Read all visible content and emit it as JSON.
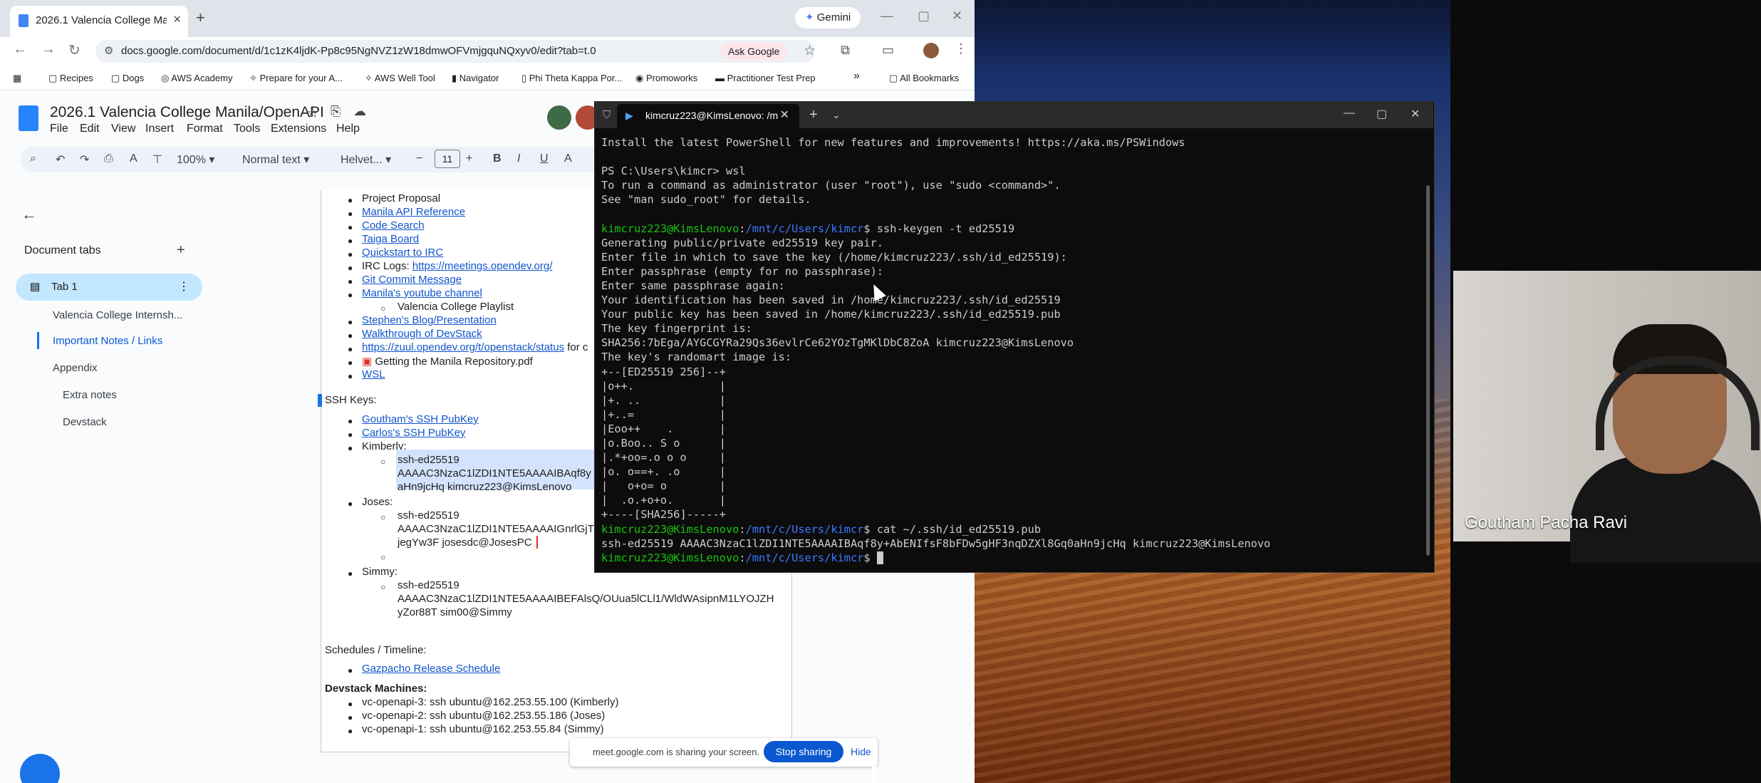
{
  "browser": {
    "tab_title": "2026.1 Valencia College Manila",
    "new_tab": "+",
    "gemini_label": "Gemini",
    "url": "docs.google.com/document/d/1c1zK4ljdK-Pp8c95NgNVZ1zW18dmwOFVmjgquNQxyv0/edit?tab=t.0",
    "ask_google": "Ask Google",
    "bookmarks": [
      "Recipes",
      "Dogs",
      "AWS Academy",
      "Prepare for your A...",
      "AWS Well Tool",
      "Navigator",
      "Phi Theta Kappa Por...",
      "Promoworks",
      "Practitioner Test Prep"
    ],
    "bookmarks_more": "»",
    "all_bookmarks": "All Bookmarks"
  },
  "docs": {
    "title": "2026.1 Valencia College Manila/OpenAPI",
    "menu": [
      "File",
      "Edit",
      "View",
      "Insert",
      "Format",
      "Tools",
      "Extensions",
      "Help"
    ],
    "zoom": "100%",
    "style": "Normal text",
    "font": "Helvet...",
    "font_size": "11",
    "sidebar": {
      "title": "Document tabs",
      "add": "+",
      "tab1": "Tab 1",
      "items": [
        "Valencia College Internsh...",
        "Important Notes / Links",
        "Appendix",
        "Extra notes",
        "Devstack"
      ]
    },
    "content": {
      "project_proposal": "Project Proposal",
      "links": [
        "Manila API Reference",
        "Code Search",
        "Taiga Board",
        "Quickstart to IRC"
      ],
      "irc_logs_label": "IRC Logs: ",
      "irc_logs_url": "https://meetings.opendev.org/",
      "links2": [
        "Git Commit Message",
        "Manila's youtube channel"
      ],
      "playlist": "Valencia College Playlist",
      "links3": [
        "Stephen's Blog/Presentation",
        "Walkthrough of DevStack"
      ],
      "zuul_url": "https://zuul.opendev.org/t/openstack/status",
      "zuul_after": " for c",
      "pdf": "Getting the Manila Repository.pdf",
      "wsl": "WSL",
      "ssh_keys": "SSH Keys:",
      "goutham_key": "Goutham's SSH PubKey",
      "carlos_key": "Carlos's SSH PubKey",
      "kimberly": "Kimberly:",
      "kim_key": [
        "ssh-ed25519",
        "AAAAC3NzaC1lZDI1NTE5AAAAIBAqf8y",
        "aHn9jcHq kimcruz223@KimsLenovo"
      ],
      "joses": "Joses:",
      "jose_key": [
        "ssh-ed25519",
        "AAAAC3NzaC1lZDI1NTE5AAAAIGnrlGjT",
        "jegYw3F josesdc@JosesPC"
      ],
      "simmy": "Simmy:",
      "simmy_key": [
        "ssh-ed25519",
        "AAAAC3NzaC1lZDI1NTE5AAAAIBEFAlsQ/OUua5lCLl1/WldWAsipnM1LYOJZH",
        "yZor88T sim00@Simmy"
      ],
      "schedules": "Schedules / Timeline:",
      "gazpacho": "Gazpacho Release Schedule",
      "devstack": "Devstack Machines:",
      "machines": [
        "vc-openapi-3: ssh ubuntu@162.253.55.100 (Kimberly)",
        "vc-openapi-2: ssh ubuntu@162.253.55.186 (Joses)",
        "vc-openapi-1: ssh ubuntu@162.253.55.84 (Simmy)"
      ]
    }
  },
  "meet": {
    "sharing": "meet.google.com is sharing your screen.",
    "stop": "Stop sharing",
    "hide": "Hide"
  },
  "terminal": {
    "tab_title": "kimcruz223@KimsLenovo: /m",
    "prompt_user": "kimcruz223@KimsLenovo",
    "prompt_path": "/mnt/c/Users/kimcr",
    "l1": "Install the latest PowerShell for new features and improvements! https://aka.ms/PSWindows",
    "l2": "PS C:\\Users\\kimcr> wsl",
    "l3": "To run a command as administrator (user \"root\"), use \"sudo <command>\".",
    "l4": "See \"man sudo_root\" for details.",
    "cmd1": "$ ssh-keygen -t ed25519",
    "l5": "Generating public/private ed25519 key pair.",
    "l6": "Enter file in which to save the key (/home/kimcruz223/.ssh/id_ed25519):",
    "l7": "Enter passphrase (empty for no passphrase):",
    "l8": "Enter same passphrase again:",
    "l9": "Your identification has been saved in /home/kimcruz223/.ssh/id_ed25519",
    "l10": "Your public key has been saved in /home/kimcruz223/.ssh/id_ed25519.pub",
    "l11": "The key fingerprint is:",
    "l12": "SHA256:7bEga/AYGCGYRa29Qs36evlrCe62YOzTgMKlDbC8ZoA kimcruz223@KimsLenovo",
    "l13": "The key's randomart image is:",
    "art": "+--[ED25519 256]--+\n|o++.             |\n|+. ..            |\n|+..=             |\n|Eoo++    .       |\n|o.Boo.. S o      |\n|.*+oo=.o o o     |\n|o. o==+. .o      |\n|   o+o= o        |\n|  .o.+o+o.       |\n+----[SHA256]-----+",
    "cmd2": "$ cat ~/.ssh/id_ed25519.pub",
    "l14": "ssh-ed25519 AAAAC3NzaC1lZDI1NTE5AAAAIBAqf8y+AbENIfsF8bFDw5gHF3nqDZXl8Gq0aHn9jcHq kimcruz223@KimsLenovo",
    "cmd3": "$ "
  },
  "video": {
    "name": "Goutham Pacha Ravi"
  }
}
